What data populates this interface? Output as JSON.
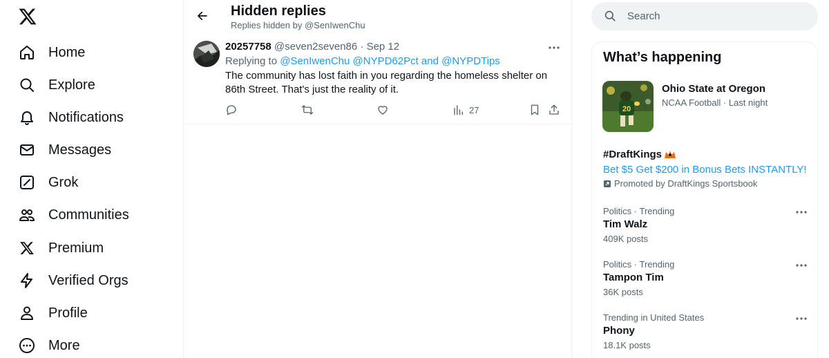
{
  "nav": {
    "logo": "x-logo",
    "items": [
      {
        "label": "Home",
        "icon": "home-icon"
      },
      {
        "label": "Explore",
        "icon": "search-icon"
      },
      {
        "label": "Notifications",
        "icon": "bell-icon"
      },
      {
        "label": "Messages",
        "icon": "envelope-icon"
      },
      {
        "label": "Grok",
        "icon": "grok-icon"
      },
      {
        "label": "Communities",
        "icon": "people-icon"
      },
      {
        "label": "Premium",
        "icon": "x-logo-icon"
      },
      {
        "label": "Verified Orgs",
        "icon": "lightning-icon"
      },
      {
        "label": "Profile",
        "icon": "person-icon"
      },
      {
        "label": "More",
        "icon": "more-circle-icon"
      }
    ]
  },
  "header": {
    "title": "Hidden replies",
    "subtitle": "Replies hidden by @SenIwenChu"
  },
  "tweet": {
    "name": "20257758",
    "handle": "@seven2seven86",
    "separator": "·",
    "date": "Sep 12",
    "replying_prefix": "Replying to ",
    "replying_to": "@SenIwenChu @NYPD62Pct and @NYPDTips",
    "text": "The community has lost faith in you regarding the homeless shelter on 86th Street. That's just the reality of it.",
    "views": "27"
  },
  "search": {
    "placeholder": "Search"
  },
  "trends": {
    "title": "What’s happening",
    "news": {
      "title": "Ohio State at Oregon",
      "meta": "NCAA Football · Last night"
    },
    "promo": {
      "tag": "#DraftKings",
      "text": "Bet $5 Get $200 in Bonus Bets INSTANTLY!",
      "by": "Promoted by DraftKings Sportsbook"
    },
    "items": [
      {
        "context": "Politics · Trending",
        "name": "Tim Walz",
        "posts": "409K posts"
      },
      {
        "context": "Politics · Trending",
        "name": "Tampon Tim",
        "posts": "36K posts"
      },
      {
        "context": "Trending in United States",
        "name": "Phony",
        "posts": "18.1K posts"
      }
    ]
  },
  "colors": {
    "accent": "#1d9bf0",
    "text": "#0f1419",
    "muted": "#536471",
    "divider": "#eff3f4"
  }
}
